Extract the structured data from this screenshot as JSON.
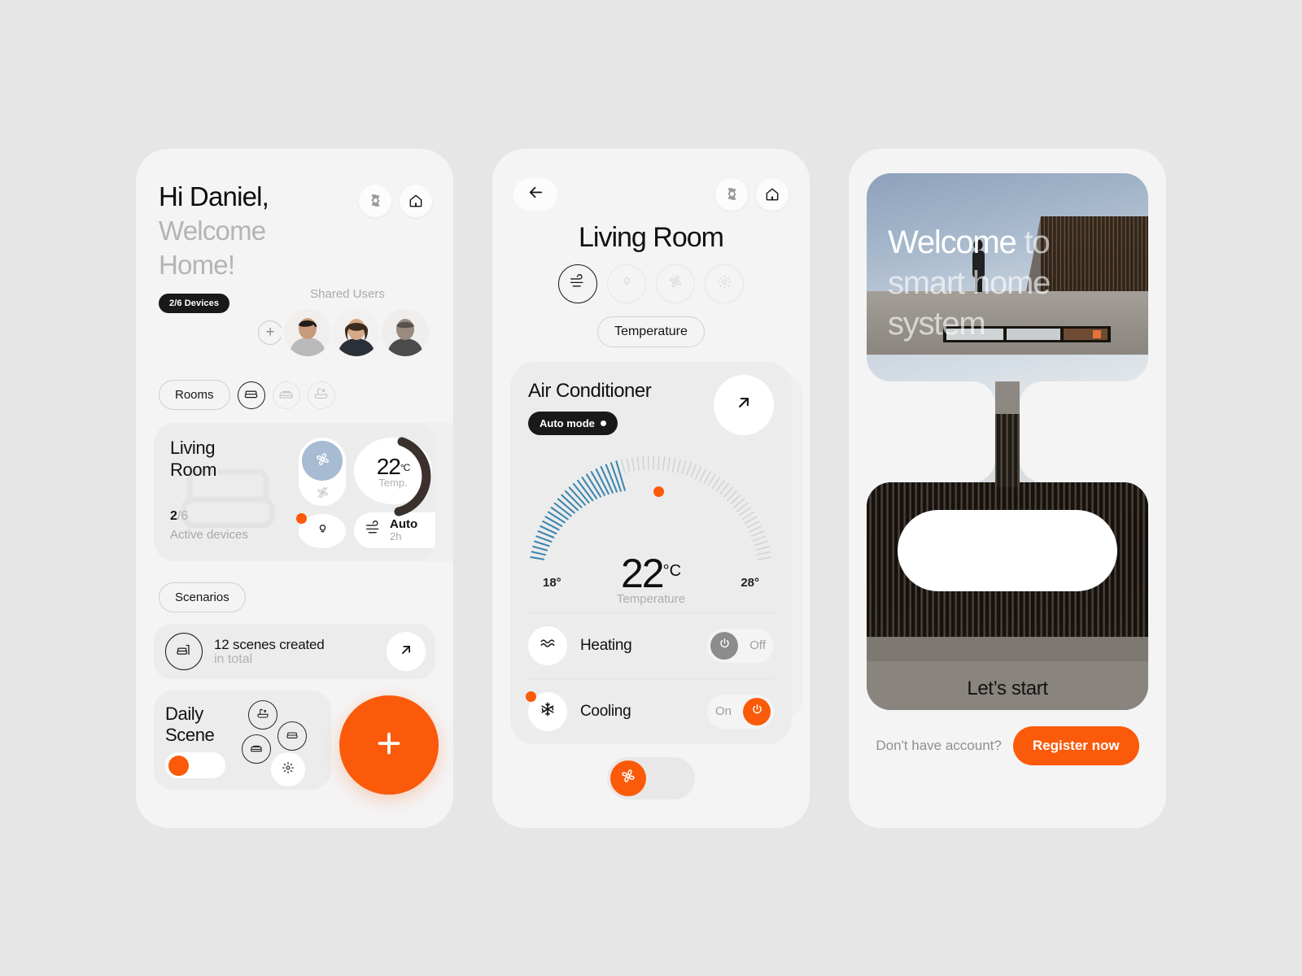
{
  "accent": "#fa5a0a",
  "phone_home": {
    "greeting_line1": "Hi Daniel,",
    "greeting_line2": "Welcome",
    "greeting_line3": "Home!",
    "devices_badge": "2/6 Devices",
    "shared_users_label": "Shared Users",
    "add_user_symbol": "+",
    "rooms_chip": "Rooms",
    "room_tabs": [
      "sofa-icon",
      "bed-icon",
      "bathtub-icon"
    ],
    "room_card": {
      "name_line1": "Living",
      "name_line2": "Room",
      "active_count": "2",
      "active_total": "/6",
      "active_label": "Active devices",
      "temperature": "22",
      "temperature_unit": "°C",
      "temperature_label": "Temp.",
      "fan_mode": "Auto",
      "fan_duration": "2h"
    },
    "scenarios_chip": "Scenarios",
    "scenario_row": {
      "title": "12 scenes created",
      "subtitle": "in total"
    },
    "daily_scene": {
      "title_line1": "Daily",
      "title_line2": "Scene"
    },
    "fab_symbol": "+"
  },
  "phone_room": {
    "title": "Living Room",
    "modes": [
      "air-icon",
      "bulb-icon",
      "fan-icon",
      "brightness-icon"
    ],
    "active_mode_index": 0,
    "temperature_chip": "Temperature",
    "device": {
      "name": "Air Conditioner",
      "mode_badge": "Auto mode",
      "gauge_min": "18°",
      "gauge_max": "28°",
      "value": "22",
      "unit": "°C",
      "value_label": "Temperature"
    },
    "rows": [
      {
        "name": "Heating",
        "state": "Off",
        "on": false,
        "icon": "waves-icon"
      },
      {
        "name": "Cooling",
        "state": "On",
        "on": true,
        "icon": "snowflake-icon"
      }
    ]
  },
  "phone_welcome": {
    "headline_strong": "Welcome",
    "headline_rest": " to smart home system",
    "start_button": "Let’s start",
    "footer_question": "Don't have account?",
    "register_button": "Register now"
  }
}
